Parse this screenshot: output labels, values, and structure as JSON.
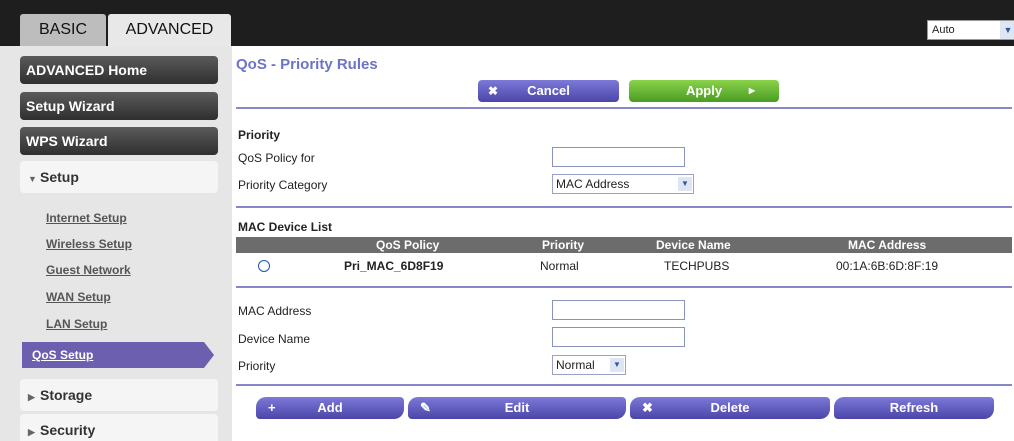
{
  "tabs": {
    "basic": "BASIC",
    "advanced": "ADVANCED"
  },
  "language_select": {
    "value": "Auto"
  },
  "sidebar": {
    "advanced_home": "ADVANCED Home",
    "setup_wizard": "Setup Wizard",
    "wps_wizard": "WPS Wizard",
    "setup": "Setup",
    "setup_items": [
      "Internet Setup",
      "Wireless Setup",
      "Guest Network",
      "WAN Setup",
      "LAN Setup"
    ],
    "active_item": "QoS Setup",
    "storage": "Storage",
    "security": "Security"
  },
  "page": {
    "title": "QoS - Priority Rules",
    "cancel": "Cancel",
    "apply": "Apply"
  },
  "priority": {
    "heading": "Priority",
    "policy_label": "QoS Policy for",
    "policy_value": "",
    "category_label": "Priority Category",
    "category_value": "MAC Address"
  },
  "mac_list": {
    "heading": "MAC Device List",
    "columns": [
      "QoS Policy",
      "Priority",
      "Device Name",
      "MAC Address"
    ],
    "rows": [
      {
        "policy": "Pri_MAC_6D8F19",
        "priority": "Normal",
        "device": "TECHPUBS",
        "mac": "00:1A:6B:6D:8F:19"
      }
    ]
  },
  "form": {
    "mac_label": "MAC Address",
    "mac_value": "",
    "name_label": "Device Name",
    "name_value": "",
    "priority_label": "Priority",
    "priority_value": "Normal"
  },
  "actions": {
    "add": "Add",
    "edit": "Edit",
    "delete": "Delete",
    "refresh": "Refresh"
  },
  "colors": {
    "accent": "#6c5fb0",
    "apply_green": "#4a9c23",
    "divider": "#8a86cc"
  }
}
